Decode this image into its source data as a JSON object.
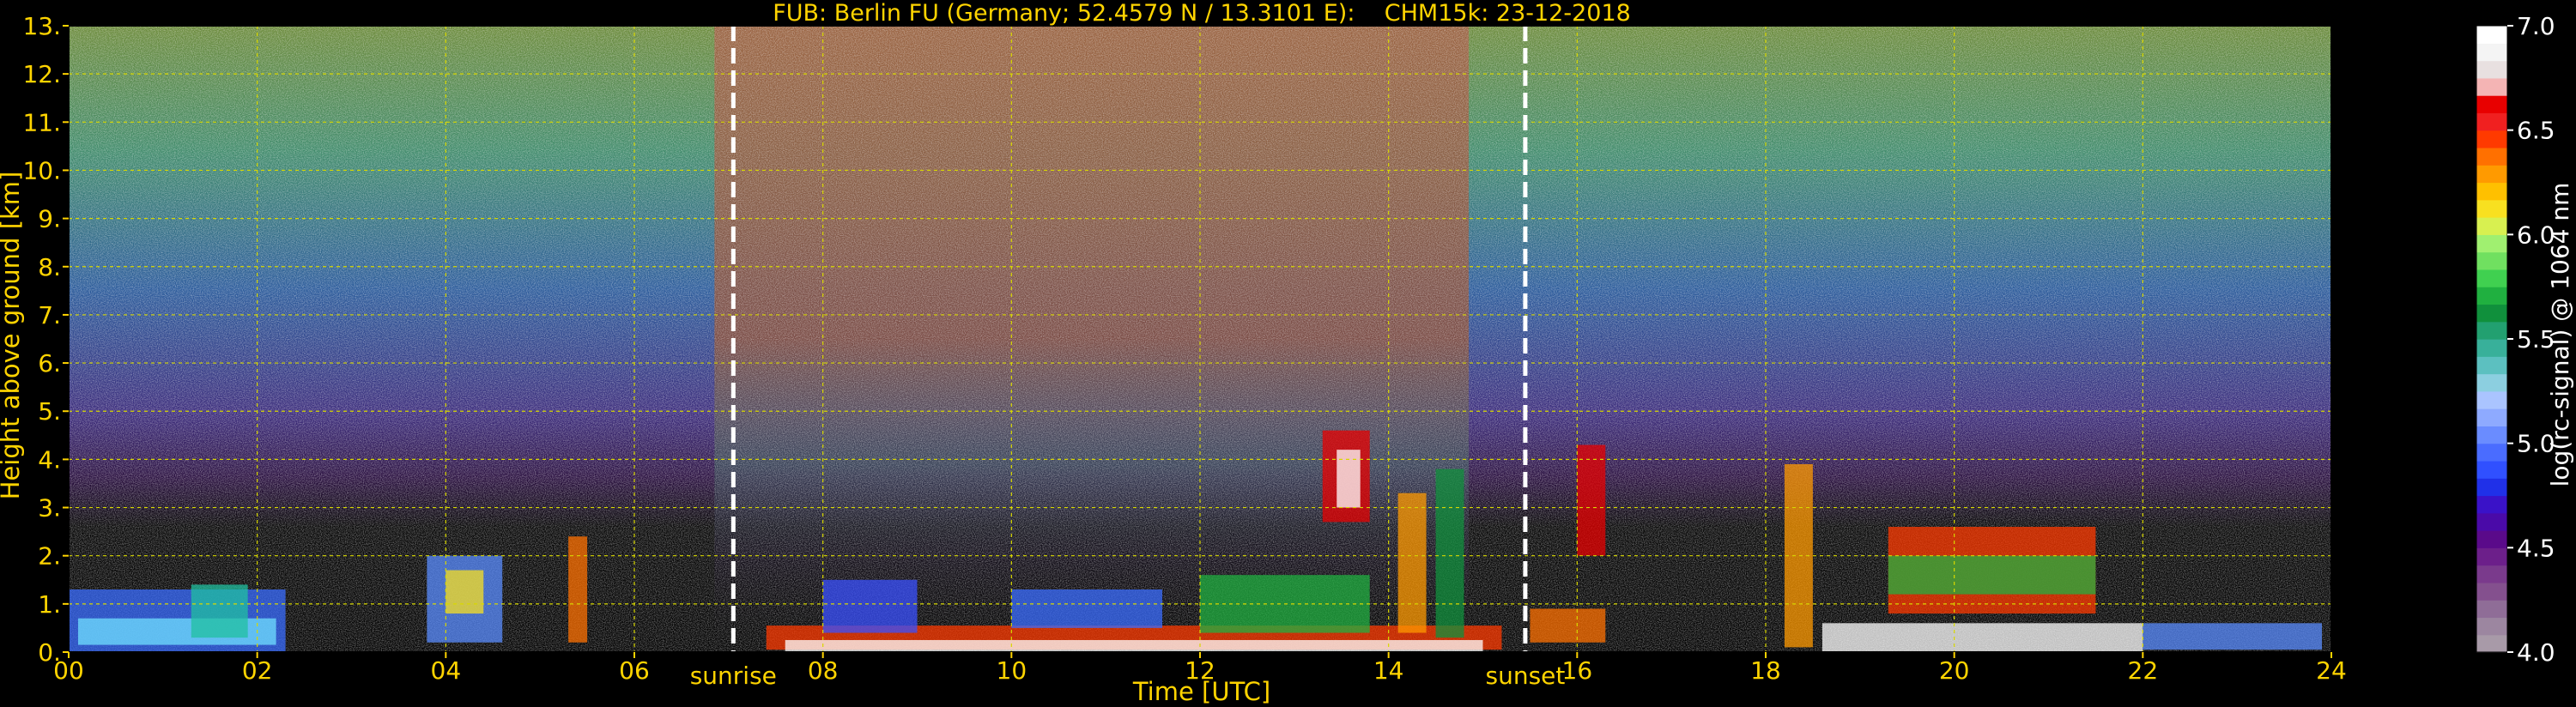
{
  "chart_data": {
    "type": "heatmap",
    "title": "FUB: Berlin FU (Germany; 52.4579 N / 13.3101 E):    CHM15k: 23-12-2018",
    "xlabel": "Time [UTC]",
    "ylabel": "Height above ground [km]",
    "xlim": [
      0,
      24
    ],
    "ylim": [
      0,
      13
    ],
    "x_ticks": [
      "00",
      "02",
      "04",
      "06",
      "08",
      "10",
      "12",
      "14",
      "16",
      "18",
      "20",
      "22",
      "24"
    ],
    "y_ticks": [
      "0.",
      "1.",
      "2.",
      "3.",
      "4.",
      "5.",
      "6.",
      "7.",
      "8.",
      "9.",
      "10.",
      "11.",
      "12.",
      "13."
    ],
    "grid": true,
    "events": [
      {
        "name": "sunrise",
        "time": 7.05
      },
      {
        "name": "sunset",
        "time": 15.45
      }
    ],
    "colorbar": {
      "label": "log(rc-signal) @ 1064 nm",
      "range": [
        4.0,
        7.0
      ],
      "ticks": [
        "4.0",
        "4.5",
        "5.0",
        "5.5",
        "6.0",
        "6.5",
        "7.0"
      ],
      "colors": [
        "#a89aa8",
        "#9c86a0",
        "#8f6d97",
        "#84508e",
        "#7a3a8c",
        "#6c1f8a",
        "#5a0a8a",
        "#4a0aa8",
        "#3a12c8",
        "#2030e8",
        "#3050ff",
        "#4a6cff",
        "#6a8cff",
        "#8eaaff",
        "#aac4ff",
        "#8ccfe0",
        "#5cc0c0",
        "#38b09a",
        "#22a070",
        "#10903c",
        "#20b040",
        "#40d050",
        "#70e060",
        "#a0f070",
        "#d8f050",
        "#f8e020",
        "#ffc000",
        "#ff9a00",
        "#ff7000",
        "#ff3a00",
        "#f02020",
        "#e80000",
        "#f4b4b4",
        "#e8e0e0",
        "#f4f4f4",
        "#ffffff"
      ]
    },
    "description_layers": {
      "background_gradient_by_height": "noise-dominated signal, purple near 3-4 km grading to blue/green/yellow aloft",
      "daytime_background": "reddish/orange noise between sunrise and sunset"
    }
  }
}
